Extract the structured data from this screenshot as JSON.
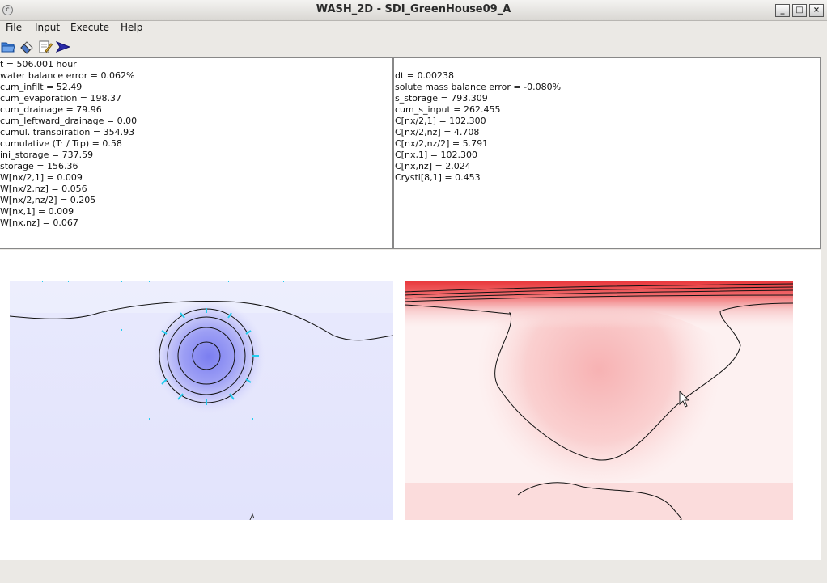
{
  "window": {
    "title": "WASH_2D  -  SDI_GreenHouse09_A"
  },
  "menu": {
    "file": "File",
    "input": "Input",
    "execute": "Execute",
    "help": "Help"
  },
  "toolbar": {
    "icons": [
      "folder-open-icon",
      "eraser-icon",
      "edit-icon",
      "run-arrow-icon"
    ]
  },
  "water_panel": {
    "lines": [
      "t = 506.001 hour",
      "water balance error = 0.062%",
      "cum_infilt = 52.49",
      "cum_evaporation = 198.37",
      "cum_drainage = 79.96",
      "cum_leftward_drainage = 0.00",
      "cumul. transpiration = 354.93",
      "cumulative (Tr / Trp) = 0.58",
      "ini_storage = 737.59",
      "storage = 156.36",
      "W[nx/2,1] = 0.009",
      "W[nx/2,nz] = 0.056",
      "W[nx/2,nz/2] = 0.205",
      "W[nx,1] = 0.009",
      "W[nx,nz] = 0.067"
    ]
  },
  "solute_panel": {
    "lines": [
      "dt = 0.00238",
      "solute mass balance error = -0.080%",
      "s_storage = 793.309",
      "cum_s_input = 262.455",
      "C[nx/2,1] = 102.300",
      "C[nx/2,nz] = 4.708",
      "C[nx/2,nz/2] = 5.791",
      "C[nx,1] = 102.300",
      "C[nx,nz] = 2.024",
      "Crystl[8,1] = 0.453"
    ]
  },
  "plots": {
    "water_content_color": "#7b7ef0",
    "solute_color": "#e8363a",
    "vector_color": "#22ccee"
  }
}
